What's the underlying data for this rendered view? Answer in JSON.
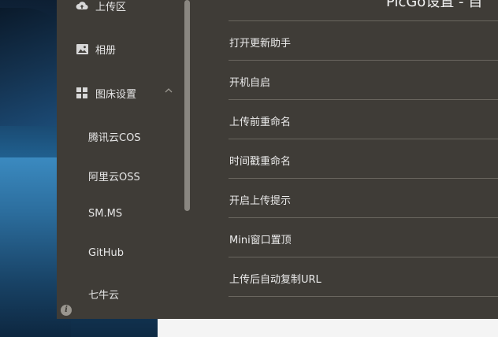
{
  "window": {
    "title": "PicGo设置 - 自"
  },
  "sidebar": {
    "items": [
      {
        "label": "上传区",
        "icon": "cloud-upload-icon"
      },
      {
        "label": "相册",
        "icon": "image-icon"
      },
      {
        "label": "图床设置",
        "icon": "grid-icon",
        "expanded": true
      }
    ],
    "sub_items": [
      {
        "label": "腾讯云COS"
      },
      {
        "label": "阿里云OSS"
      },
      {
        "label": "SM.MS"
      },
      {
        "label": "GitHub"
      },
      {
        "label": "七牛云"
      }
    ],
    "info_icon": "i"
  },
  "settings": {
    "rows": [
      {
        "label": "打开更新助手"
      },
      {
        "label": "开机自启"
      },
      {
        "label": "上传前重命名"
      },
      {
        "label": "时间戳重命名"
      },
      {
        "label": "开启上传提示"
      },
      {
        "label": "Mini窗口置顶"
      },
      {
        "label": "上传后自动复制URL"
      }
    ]
  },
  "colors": {
    "window_bg": "#3f3c37",
    "divider": "#6a665f",
    "text": "#ececec"
  }
}
